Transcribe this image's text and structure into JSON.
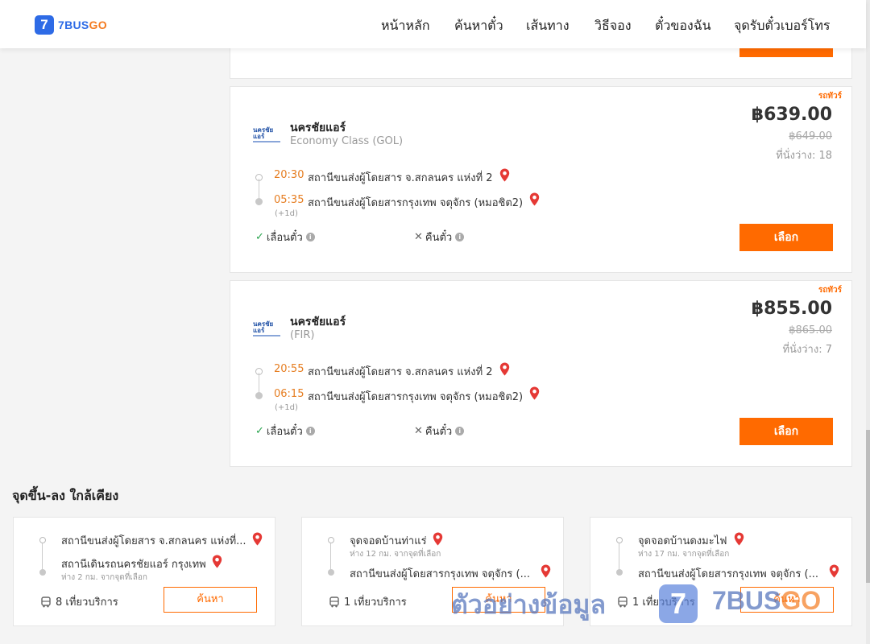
{
  "header": {
    "logo_mark": "7",
    "logo_text_part1": "7BUS",
    "logo_text_part2": "GO",
    "nav": [
      "หน้าหลัก",
      "ค้นหาตั๋ว",
      "เส้นทาง",
      "วิธีจอง",
      "ตั๋วของฉัน",
      "จุดรับตั๋วเบอร์โทร"
    ]
  },
  "trips": [
    {
      "badge": "รถทัวร์",
      "operator_logo_text": "นครชัยแอร์",
      "operator": "นครชัยแอร์",
      "bus_class": "Economy Class (GOL)",
      "price": "฿639.00",
      "price_old": "฿649.00",
      "seats": "ที่นั่งว่าง: 18",
      "depart_time": "20:30",
      "depart_stop": "สถานีขนส่งผู้โดยสาร จ.สกลนคร แห่งที่ 2",
      "arrive_time": "05:35",
      "arrive_stop": "สถานีขนส่งผู้โดยสารกรุงเทพ จตุจักร (หมอชิต2)",
      "next_day": "(+1d)",
      "reschedule": "เลื่อนตั๋ว",
      "refund": "คืนตั๋ว",
      "select_label": "เลือก"
    },
    {
      "badge": "รถทัวร์",
      "operator_logo_text": "นครชัยแอร์",
      "operator": "นครชัยแอร์",
      "bus_class": "(FIR)",
      "price": "฿855.00",
      "price_old": "฿865.00",
      "seats": "ที่นั่งว่าง: 7",
      "depart_time": "20:55",
      "depart_stop": "สถานีขนส่งผู้โดยสาร จ.สกลนคร แห่งที่ 2",
      "arrive_time": "06:15",
      "arrive_stop": "สถานีขนส่งผู้โดยสารกรุงเทพ จตุจักร (หมอชิต2)",
      "next_day": "(+1d)",
      "reschedule": "เลื่อนตั๋ว",
      "refund": "คืนตั๋ว",
      "select_label": "เลือก"
    }
  ],
  "nearby": {
    "title": "จุดขึ้น-ลง ใกล้เคียง",
    "cards": [
      {
        "from": "สถานีขนส่งผู้โดยสาร จ.สกลนคร แห่งที่...",
        "from_dist": "",
        "to": "สถานีเดินรถนครชัยแอร์ กรุงเทพ",
        "to_dist": "ห่าง 2 กม. จากจุดที่เลือก",
        "trips": "8 เที่ยวบริการ",
        "button": "ค้นหา"
      },
      {
        "from": "จุดจอดบ้านท่าแร่",
        "from_dist": "ห่าง 12 กม. จากจุดที่เลือก",
        "to": "สถานีขนส่งผู้โดยสารกรุงเทพ จตุจักร (...",
        "to_dist": "",
        "trips": "1 เที่ยวบริการ",
        "button": "ค้นหา"
      },
      {
        "from": "จุดจอดบ้านดงมะไฟ",
        "from_dist": "ห่าง 17 กม. จากจุดที่เลือก",
        "to": "สถานีขนส่งผู้โดยสารกรุงเทพ จตุจักร (...",
        "to_dist": "",
        "trips": "1 เที่ยวบริการ",
        "button": "ค้นหา"
      }
    ]
  },
  "watermark": {
    "text": "ตัวอย่างข้อมูล",
    "logo_mark": "7",
    "brand_part1": "7BUS",
    "brand_part2": "GO"
  },
  "colors": {
    "accent": "#ff6a00",
    "brand_blue": "#2e6be6",
    "time_orange": "#e67e22",
    "pin_red": "#e53935",
    "check_green": "#2aa44f"
  }
}
